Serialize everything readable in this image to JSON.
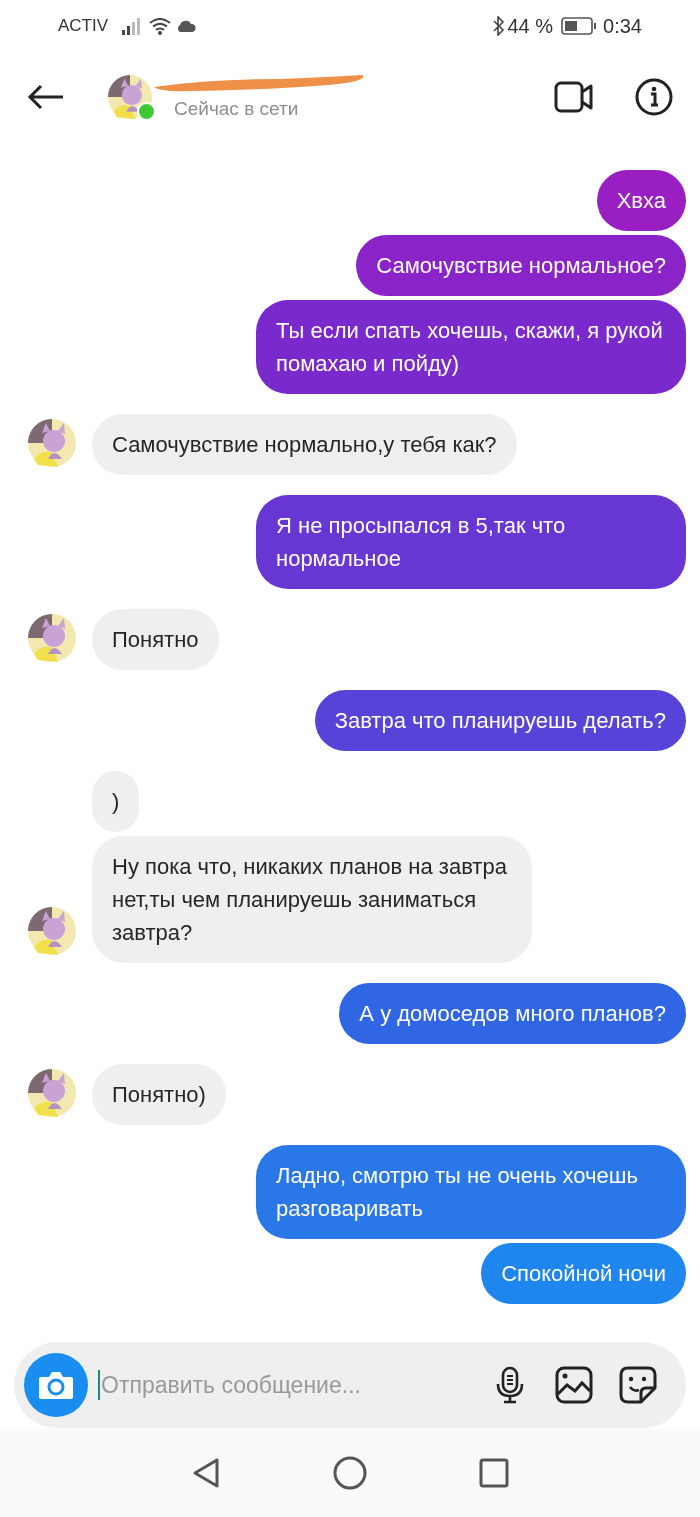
{
  "status_bar": {
    "carrier": "ACTIV",
    "battery": "44 %",
    "time": "0:34"
  },
  "header": {
    "status": "Сейчас в сети",
    "online": true
  },
  "messages": [
    {
      "kind": "sent",
      "text": "Хвха",
      "color": "#9a1fc2"
    },
    {
      "kind": "sent",
      "text": "Самочувствие нормальное?",
      "color": "#8a24c8"
    },
    {
      "kind": "sent",
      "text": "Ты если спать хочешь, скажи, я рукой помахаю и пойду)",
      "color": "#7a2acc"
    },
    {
      "kind": "received",
      "text": "Самочувствие нормально,у тебя как?",
      "avatar": true
    },
    {
      "kind": "sent",
      "text": "Я не просыпался в 5,так что нормальное",
      "color": "#6836d2"
    },
    {
      "kind": "received",
      "text": "Понятно",
      "avatar": true
    },
    {
      "kind": "sent",
      "text": "Завтра что планируешь делать?",
      "color": "#5843d8"
    },
    {
      "kind": "received",
      "text": ")",
      "avatar": false
    },
    {
      "kind": "received",
      "text": "Ну пока что, никаких планов на завтра нет,ты чем планируешь заниматься завтра?",
      "avatar": true
    },
    {
      "kind": "sent",
      "text": "А у домоседов много планов?",
      "color": "#3066e4"
    },
    {
      "kind": "received",
      "text": "Понятно)",
      "avatar": true
    },
    {
      "kind": "sent",
      "text": "Ладно, смотрю ты не очень хочешь разговаривать",
      "color": "#2a78e8"
    },
    {
      "kind": "sent",
      "text": "Спокойной ночи",
      "color": "#1e86ee"
    }
  ],
  "composer": {
    "placeholder": "Отправить сообщение..."
  }
}
